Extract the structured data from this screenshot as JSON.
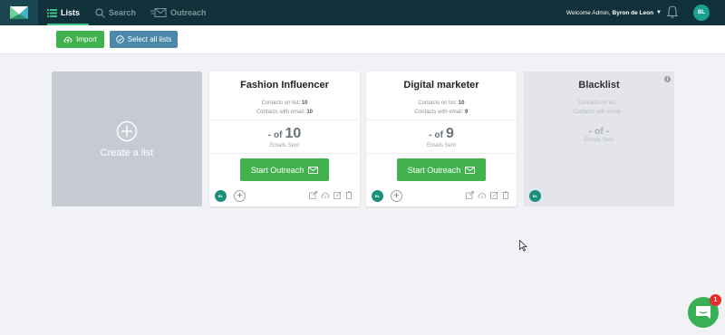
{
  "nav": {
    "lists": "Lists",
    "search": "Search",
    "outreach": "Outreach",
    "welcome_prefix": "Welcome Admin,",
    "user_name": "Byron de Leon",
    "user_initials": "BL"
  },
  "toolbar": {
    "import_label": "Import",
    "select_all_label": "Select all lists"
  },
  "create": {
    "label": "Create a list"
  },
  "cards": [
    {
      "title": "Fashion Influencer",
      "contacts_label": "Contacts on list:",
      "contacts": "10",
      "email_label": "Contacts with email:",
      "email": "10",
      "sent_dash": "-",
      "sent_of": "of",
      "sent_total": "10",
      "sent_label": "Emails Sent",
      "button": "Start Outreach",
      "owner": "BL"
    },
    {
      "title": "Digital marketer",
      "contacts_label": "Contacts on list:",
      "contacts": "10",
      "email_label": "Contacts with email:",
      "email": "9",
      "sent_dash": "-",
      "sent_of": "of",
      "sent_total": "9",
      "sent_label": "Emails Sent",
      "button": "Start Outreach",
      "owner": "BL"
    },
    {
      "title": "Blacklist",
      "contacts_label": "Contacts on list:",
      "contacts": "-",
      "email_label": "Contacts with email:",
      "email": "-",
      "sent_dash": "-",
      "sent_of": "of",
      "sent_total": "-",
      "sent_label": "Emails Sent",
      "owner": "BL"
    }
  ],
  "chat": {
    "badge": "1"
  },
  "colors": {
    "nav_bg": "#10313a",
    "accent_green": "#42b24e",
    "select_blue": "#4b88aa",
    "avatar_teal": "#1aa090"
  }
}
